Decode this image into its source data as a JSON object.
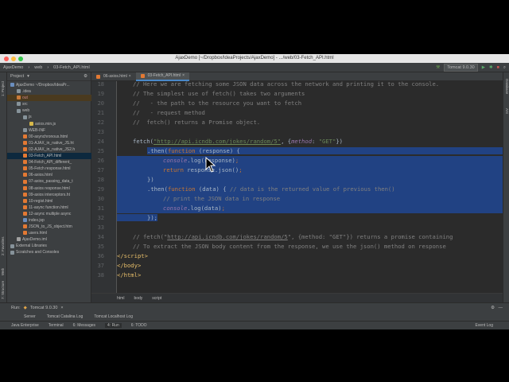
{
  "window": {
    "title": "AjaxDemo [~/Dropbox/IdeaProjects/AjaxDemo] - .../web/03-Fetch_API.html"
  },
  "navbar": {
    "crumbs": [
      "AjaxDemo",
      "web",
      "03-Fetch_API.html"
    ],
    "run_config": "Tomcat 9.0.30"
  },
  "left_tools": [
    "1: Project",
    "2: Favorites",
    "7: Structure",
    "Web"
  ],
  "right_tools": [
    "Database",
    "Ant"
  ],
  "project": {
    "header": "Project",
    "tree": [
      {
        "label": "AjaxDemo ~/Dropbox/IdeaPr...",
        "kind": "module"
      },
      {
        "label": ".idea",
        "kind": "folder"
      },
      {
        "label": "out",
        "kind": "folder-excluded"
      },
      {
        "label": "src",
        "kind": "folder"
      },
      {
        "label": "web",
        "kind": "folder"
      },
      {
        "label": "js",
        "kind": "folder"
      },
      {
        "label": "axios.min.js",
        "kind": "js"
      },
      {
        "label": "WEB-INF",
        "kind": "folder"
      },
      {
        "label": "00-asynchronous.html",
        "kind": "html"
      },
      {
        "label": "01-AJAX_in_native_JS.ht",
        "kind": "html"
      },
      {
        "label": "02-AJAX_in_native_JS2.h",
        "kind": "html"
      },
      {
        "label": "03-Fetch_API.html",
        "kind": "html-selected"
      },
      {
        "label": "04-Fetch_API_different_",
        "kind": "html"
      },
      {
        "label": "05-Fetch response.html",
        "kind": "html"
      },
      {
        "label": "06-axios.html",
        "kind": "html"
      },
      {
        "label": "07-axios_passing_data_t",
        "kind": "html"
      },
      {
        "label": "08-axios response.html",
        "kind": "html"
      },
      {
        "label": "09-axios interceptors.ht",
        "kind": "html"
      },
      {
        "label": "10-regist.html",
        "kind": "html"
      },
      {
        "label": "11-async function.html",
        "kind": "html"
      },
      {
        "label": "12-async multiple async",
        "kind": "html"
      },
      {
        "label": "index.jsp",
        "kind": "jsp"
      },
      {
        "label": "JSON_to_JS_object.htm",
        "kind": "html"
      },
      {
        "label": "users.html",
        "kind": "html"
      },
      {
        "label": "AjaxDemo.iml",
        "kind": "iml"
      },
      {
        "label": "External Libraries",
        "kind": "lib"
      },
      {
        "label": "Scratches and Consoles",
        "kind": "scratch"
      }
    ]
  },
  "tabs": [
    {
      "label": "06-axios.html",
      "active": false
    },
    {
      "label": "03-Fetch_API.html",
      "active": true
    }
  ],
  "editor": {
    "lines": [
      "18",
      "19",
      "20",
      "21",
      "22",
      "23",
      "24",
      "25",
      "26",
      "27",
      "28",
      "29",
      "30",
      "31",
      "32",
      "33",
      "34",
      "35",
      "36",
      "37",
      "38"
    ]
  },
  "breadcrumbs": [
    "html",
    "body",
    "script"
  ],
  "run": {
    "label": "Run:",
    "config": "Tomcat 9.0.30",
    "tabs": [
      "Server",
      "Tomcat Catalina Log",
      "Tomcat Localhost Log"
    ]
  },
  "statusbar": {
    "items": [
      "Java Enterprise",
      "Terminal",
      "6: Messages",
      "4: Run",
      "6: TODO"
    ],
    "event_log": "Event Log"
  }
}
